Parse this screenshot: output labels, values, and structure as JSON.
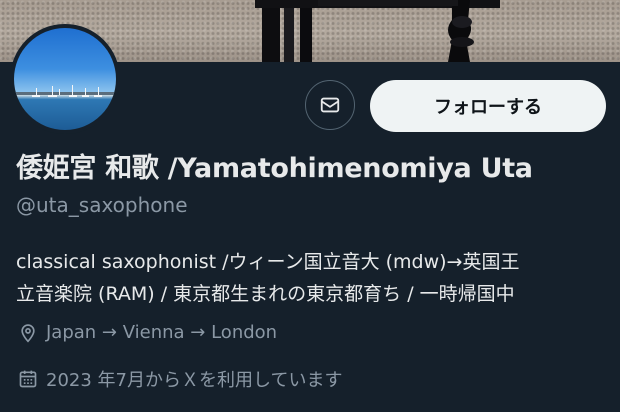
{
  "profile": {
    "display_name": "倭姫宮 和歌 /Yamatohimenomiya Uta",
    "handle": "@uta_saxophone",
    "bio_lines": [
      "classical saxophonist /ウィーン国立音大 (mdw)→英国王",
      "立音楽院 (RAM) / 東京都生まれの東京都育ち / 一時帰国中"
    ],
    "location": "Japan → Vienna → London",
    "joined": "2023 年7月からＸを利用しています"
  },
  "actions": {
    "follow_label": "フォローする",
    "message_icon": "mail-icon"
  },
  "icons": {
    "location": "location-pin-icon",
    "joined": "calendar-icon"
  },
  "colors": {
    "background": "#15202b",
    "primary_text": "#e7e9ea",
    "secondary_text": "#8b98a5",
    "follow_button_bg": "#eff3f4"
  }
}
